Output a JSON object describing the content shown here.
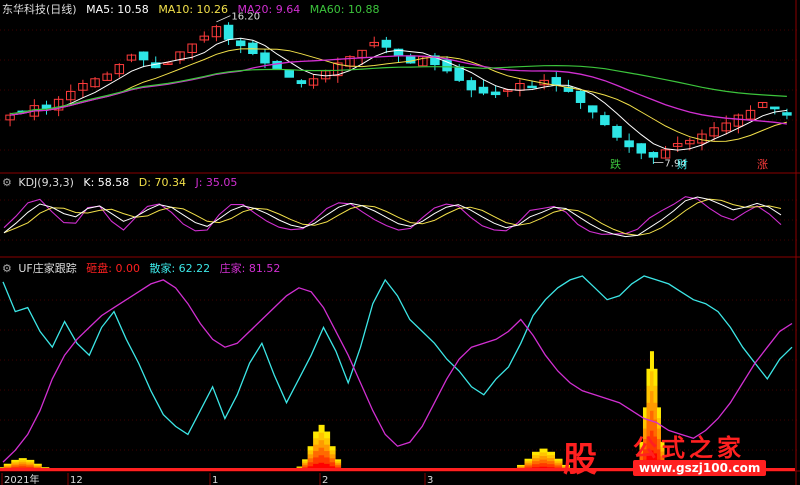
{
  "colors": {
    "background": "#000000",
    "grid": "#8a0000",
    "up": "#ff3c3c",
    "down": "#2ee6e6",
    "ma5": "#ffffff",
    "ma10": "#f2e04a",
    "ma20": "#d12fd1",
    "ma60": "#3cc43c",
    "kdj_k": "#ffffff",
    "kdj_d": "#f2e04a",
    "kdj_j": "#d12fd1",
    "uf_funds": "#ff2020",
    "uf_retail": "#3ce6e6",
    "uf_main": "#d12fd1"
  },
  "main_panel": {
    "title": "东华科技(日线)",
    "indicators": [
      {
        "label": "MA5: 10.58",
        "color": "#ffffff"
      },
      {
        "label": "MA10: 10.26",
        "color": "#f2e04a"
      },
      {
        "label": "MA20: 9.64",
        "color": "#d12fd1"
      },
      {
        "label": "MA60: 10.88",
        "color": "#3cc43c"
      }
    ],
    "high_label": "16.20",
    "low_label": "7.94",
    "signals": [
      {
        "text": "跌",
        "color": "#3cc43c"
      },
      {
        "text": "财",
        "color": "#3ce6e6"
      },
      {
        "text": "涨",
        "color": "#ff3c3c"
      }
    ]
  },
  "kdj_panel": {
    "title": "KDJ(9,3,3)",
    "k_label": "K: 58.58",
    "d_label": "D: 70.34",
    "j_label": "J: 35.05"
  },
  "uf_panel": {
    "title": "UF庄家跟踪",
    "funds_label": "砸盘: 0.00",
    "retail_label": "散家: 62.22",
    "main_label": "庄家: 81.52"
  },
  "x_axis": {
    "labels": [
      "2021年",
      "12",
      "1",
      "2",
      "3"
    ]
  },
  "watermark": {
    "logo_char": "股",
    "site_name": "公式之家",
    "url": "www.gszj100.com"
  },
  "chart_data": [
    {
      "type": "candlestick",
      "title": "东华科技(日线)",
      "series": [
        {
          "name": "MA5",
          "value": 10.58
        },
        {
          "name": "MA10",
          "value": 10.26
        },
        {
          "name": "MA20",
          "value": 9.64
        },
        {
          "name": "MA60",
          "value": 10.88
        }
      ],
      "annotations": {
        "max_price": 16.2,
        "min_price": 7.94
      },
      "close_path": [
        10.6,
        10.8,
        11.2,
        11.0,
        11.6,
        12.1,
        12.6,
        12.9,
        13.2,
        13.8,
        14.4,
        14.1,
        13.6,
        13.9,
        14.6,
        15.1,
        15.6,
        16.2,
        15.4,
        15.0,
        14.5,
        13.9,
        13.5,
        13.0,
        12.6,
        12.9,
        13.4,
        13.9,
        14.3,
        14.7,
        15.2,
        14.9,
        14.4,
        13.9,
        14.3,
        13.8,
        13.4,
        12.8,
        12.2,
        12.0,
        11.9,
        12.2,
        12.6,
        12.4,
        12.8,
        12.5,
        12.1,
        11.4,
        10.8,
        10.0,
        9.2,
        8.6,
        8.2,
        7.94,
        8.4,
        8.8,
        9.0,
        9.4,
        9.8,
        10.1,
        10.6,
        10.9,
        11.4,
        11.0,
        10.6
      ]
    },
    {
      "type": "line",
      "title": "KDJ(9,3,3)",
      "series": [
        {
          "name": "K",
          "last": 58.58
        },
        {
          "name": "D",
          "last": 70.34
        },
        {
          "name": "J",
          "last": 35.05
        }
      ],
      "k_values": [
        30,
        45,
        62,
        75,
        70,
        60,
        55,
        68,
        72,
        60,
        48,
        55,
        66,
        74,
        70,
        58,
        46,
        40,
        52,
        65,
        72,
        68,
        60,
        50,
        42,
        38,
        45,
        58,
        70,
        76,
        72,
        64,
        54,
        44,
        40,
        48,
        60,
        70,
        74,
        66,
        55,
        45,
        38,
        42,
        55,
        62,
        70,
        68,
        56,
        44,
        34,
        28,
        24,
        26,
        38,
        50,
        64,
        80,
        86,
        82,
        74,
        66,
        70,
        76,
        70,
        58
      ]
    },
    {
      "type": "line",
      "title": "UF庄家跟踪",
      "series": [
        {
          "name": "砸盘",
          "last": 0.0
        },
        {
          "name": "散家",
          "last": 62.22
        },
        {
          "name": "庄家",
          "last": 81.52
        }
      ],
      "retail_values": [
        95,
        80,
        82,
        70,
        62,
        75,
        64,
        58,
        72,
        80,
        66,
        54,
        40,
        28,
        22,
        18,
        30,
        42,
        26,
        38,
        54,
        64,
        48,
        34,
        46,
        58,
        72,
        60,
        44,
        62,
        84,
        96,
        88,
        76,
        70,
        64,
        56,
        50,
        42,
        38,
        46,
        52,
        64,
        78,
        86,
        92,
        96,
        98,
        92,
        86,
        88,
        94,
        98,
        96,
        94,
        90,
        86,
        84,
        80,
        72,
        62,
        54,
        46,
        56,
        62
      ],
      "main_values": [
        4,
        10,
        18,
        30,
        46,
        58,
        66,
        72,
        78,
        82,
        86,
        90,
        94,
        96,
        92,
        84,
        74,
        66,
        62,
        64,
        70,
        76,
        82,
        88,
        92,
        90,
        82,
        70,
        58,
        44,
        30,
        18,
        12,
        14,
        22,
        34,
        46,
        56,
        62,
        64,
        66,
        70,
        76,
        68,
        58,
        50,
        44,
        40,
        38,
        36,
        34,
        30,
        26,
        24,
        20,
        18,
        16,
        20,
        26,
        34,
        44,
        54,
        62,
        70,
        74
      ],
      "funds_spikes": [
        {
          "at": 0.02,
          "value": 10
        },
        {
          "at": 0.4,
          "value": 38
        },
        {
          "at": 0.68,
          "value": 18
        },
        {
          "at": 0.82,
          "value": 100
        }
      ]
    }
  ]
}
